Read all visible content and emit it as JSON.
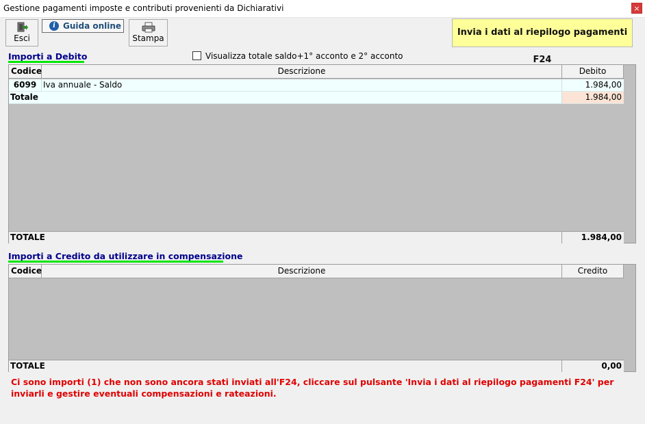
{
  "window": {
    "title": "Gestione pagamenti imposte e contributi provenienti da Dichiarativi",
    "close_glyph": "×"
  },
  "toolbar": {
    "esci_label": "Esci",
    "esci_icon": "exit-icon",
    "guida_label": "Guida online",
    "guida_icon": "info-icon",
    "stampa_label": "Stampa",
    "stampa_icon": "printer-icon",
    "invia_label": "Invia i dati al riepilogo pagamenti F24"
  },
  "debito": {
    "section_title": "Importi a Debito",
    "checkbox_label": "Visualizza totale saldo+1° acconto e 2° acconto",
    "checkbox_checked": false,
    "columns": {
      "code": "Codice",
      "description": "Descrizione",
      "amount": "Debito"
    },
    "rows": [
      {
        "code": "6099",
        "description": "Iva annuale - Saldo",
        "amount": "1.984,00"
      }
    ],
    "subtotal": {
      "label": "Totale",
      "amount": "1.984,00"
    },
    "footer": {
      "label": "TOTALE",
      "amount": "1.984,00"
    }
  },
  "credito": {
    "section_title": "Importi a Credito da utilizzare in compensazione",
    "columns": {
      "code": "Codice",
      "description": "Descrizione",
      "amount": "Credito"
    },
    "rows": [],
    "footer": {
      "label": "TOTALE",
      "amount": "0,00"
    }
  },
  "message": "Ci sono importi (1) che non sono ancora stati inviati all'F24, cliccare sul pulsante 'Invia i dati al riepilogo pagamenti F24' per inviarli e gestire eventuali compensazioni e rateazioni.",
  "colors": {
    "section_title": "#00008b",
    "underline": "#00e600",
    "invia_bg": "#ffff99",
    "message": "#e00000",
    "row_bg": "#f0ffff",
    "total_amount_bg": "#fbe4d5",
    "grid_bg": "#bfbfbf"
  }
}
